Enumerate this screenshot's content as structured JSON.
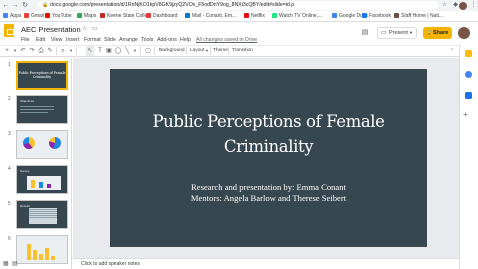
{
  "browser": {
    "url": "docs.google.com/presentation/d/1RnNjKO1kpV8GK9jzyQ2VOv_F5odDnY9og_8NXi3cQBY/edit#slide=id.p",
    "bookmarks": [
      {
        "label": "Apps",
        "color": "#4285f4"
      },
      {
        "label": "Gmail",
        "color": "#ea4335"
      },
      {
        "label": "YouTube",
        "color": "#ff0000"
      },
      {
        "label": "Maps",
        "color": "#34a853"
      },
      {
        "label": "Keene State Colle...",
        "color": "#c62828"
      },
      {
        "label": "Dashboard",
        "color": "#e53935"
      },
      {
        "label": "Mail - Conant, Em...",
        "color": "#0078d4"
      },
      {
        "label": "Netflix",
        "color": "#e50914"
      },
      {
        "label": "Watch TV Online,...",
        "color": "#1ce783"
      },
      {
        "label": "Google Docs",
        "color": "#4285f4"
      },
      {
        "label": "Facebook",
        "color": "#1877f2"
      },
      {
        "label": "Staff Home | Nati...",
        "color": "#6d4c41"
      }
    ]
  },
  "doc": {
    "title": "AEC Presentation",
    "saved_status": "All changes saved in Drive",
    "menu": [
      "File",
      "Edit",
      "View",
      "Insert",
      "Format",
      "Slide",
      "Arrange",
      "Tools",
      "Add-ons",
      "Help"
    ],
    "present_label": "Present",
    "share_label": "Share"
  },
  "toolbar": {
    "background_label": "Background",
    "layout_label": "Layout",
    "theme_label": "Theme",
    "transition_label": "Transition"
  },
  "filmstrip": {
    "numbers": [
      "1",
      "2",
      "3",
      "4",
      "5",
      "6"
    ],
    "thumb1_title": "Public Perceptions of Female Criminality",
    "thumb2_title": "Objectives",
    "thumb3_title": "Survey",
    "thumb5_title": "Results"
  },
  "slide": {
    "title": "Public Perceptions of Female Criminality",
    "subtitle_line1": "Research and presentation by: Emma Conant",
    "subtitle_line2": "Mentors: Angela Barlow and Therese Seibert",
    "background": "#37474f"
  },
  "notes_placeholder": "Click to add speaker notes"
}
